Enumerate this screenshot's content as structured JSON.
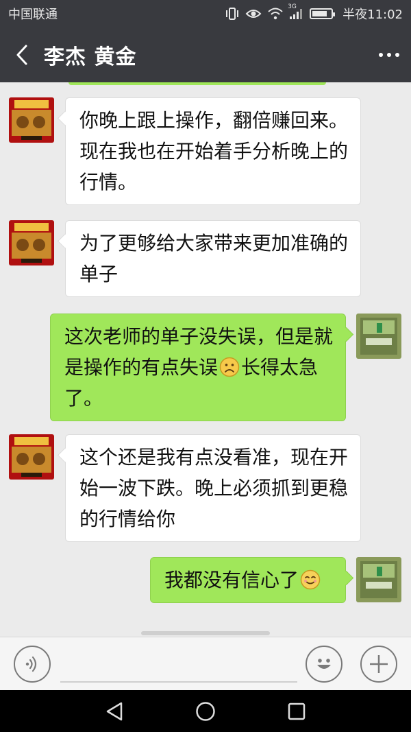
{
  "status_bar": {
    "carrier": "中国联通",
    "network": "3G",
    "time": "半夜11:02",
    "battery_level": 0.8
  },
  "header": {
    "title": "李杰  黄金",
    "back_icon": "chevron-left-icon",
    "menu_icon": "more-icon"
  },
  "messages": [
    {
      "side": "in",
      "text": "你晚上跟上操作，翻倍赚回来。现在我也在开始着手分析晚上的行情。"
    },
    {
      "side": "in",
      "text": "为了更够给大家带来更加准确的单子"
    },
    {
      "side": "out",
      "text_before": "这次老师的单子没失误，但是就是操作的有点失误",
      "emoji": "frown-emoji",
      "text_after": "长得太急了。"
    },
    {
      "side": "in",
      "text": "这个还是我有点没看准，现在开始一波下跌。晚上必须抓到更稳的行情给你"
    },
    {
      "side": "out",
      "text_before": "我都没有信心了",
      "emoji": "smile-emoji",
      "text_after": ""
    }
  ],
  "input_bar": {
    "voice_icon": "voice-icon",
    "emoji_icon": "emoji-icon",
    "add_icon": "plus-icon"
  },
  "nav_bar": {
    "back": "back-triangle-icon",
    "home": "home-circle-icon",
    "recent": "recent-square-icon"
  },
  "colors": {
    "header_bg": "#393a3f",
    "chat_bg": "#ebebeb",
    "outgoing_bubble": "#a0e75a",
    "incoming_bubble": "#ffffff"
  }
}
